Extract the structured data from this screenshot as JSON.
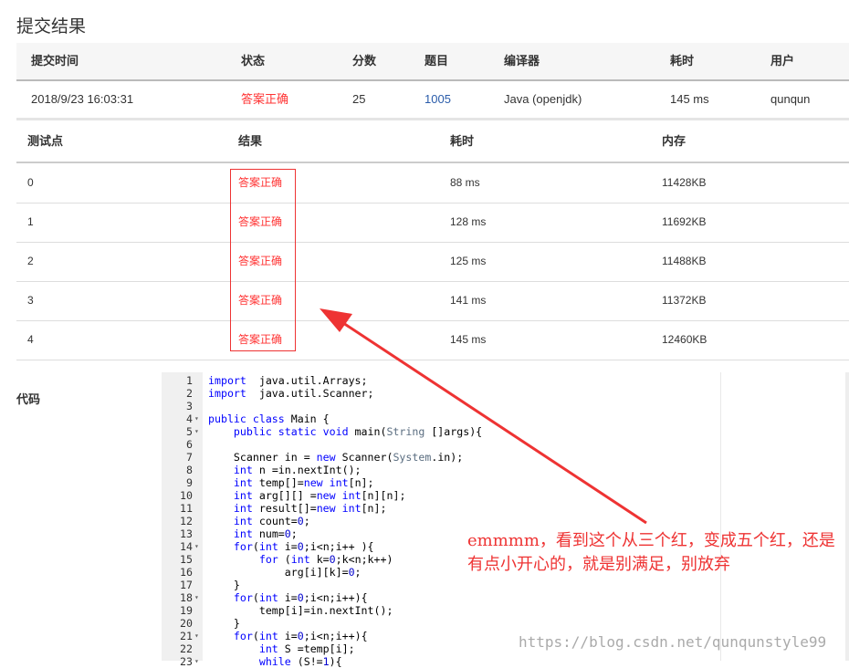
{
  "title": "提交结果",
  "summary": {
    "headers": [
      "提交时间",
      "状态",
      "分数",
      "题目",
      "编译器",
      "耗时",
      "用户"
    ],
    "row": [
      "2018/9/23 16:03:31",
      "答案正确",
      "25",
      "1005",
      "Java (openjdk)",
      "145 ms",
      "qunqun"
    ]
  },
  "tests": {
    "headers": [
      "测试点",
      "结果",
      "耗时",
      "内存"
    ],
    "rows": [
      [
        "0",
        "答案正确",
        "88 ms",
        "11428KB"
      ],
      [
        "1",
        "答案正确",
        "128 ms",
        "11692KB"
      ],
      [
        "2",
        "答案正确",
        "125 ms",
        "11488KB"
      ],
      [
        "3",
        "答案正确",
        "141 ms",
        "11372KB"
      ],
      [
        "4",
        "答案正确",
        "145 ms",
        "12460KB"
      ]
    ]
  },
  "code_label": "代码",
  "code": [
    [
      1,
      "",
      [
        [
          "kw",
          "import"
        ],
        [
          "",
          "  java.util.Arrays;"
        ]
      ]
    ],
    [
      2,
      "",
      [
        [
          "kw",
          "import"
        ],
        [
          "",
          "  java.util.Scanner;"
        ]
      ]
    ],
    [
      3,
      "",
      []
    ],
    [
      4,
      "▾",
      [
        [
          "kw",
          "public class"
        ],
        [
          "",
          " Main {"
        ]
      ]
    ],
    [
      5,
      "▾",
      [
        [
          "",
          "    "
        ],
        [
          "kw",
          "public static void"
        ],
        [
          "",
          " main("
        ],
        [
          "cls",
          "String"
        ],
        [
          "",
          " []args){"
        ]
      ]
    ],
    [
      6,
      "",
      []
    ],
    [
      7,
      "",
      [
        [
          "",
          "    Scanner in = "
        ],
        [
          "kw",
          "new"
        ],
        [
          "",
          " Scanner("
        ],
        [
          "cls",
          "System"
        ],
        [
          "",
          ".in);"
        ]
      ]
    ],
    [
      8,
      "",
      [
        [
          "",
          "    "
        ],
        [
          "kw",
          "int"
        ],
        [
          "",
          " n =in.nextInt();"
        ]
      ]
    ],
    [
      9,
      "",
      [
        [
          "",
          "    "
        ],
        [
          "kw",
          "int"
        ],
        [
          "",
          " temp[]="
        ],
        [
          "kw",
          "new int"
        ],
        [
          "",
          "[n];"
        ]
      ]
    ],
    [
      10,
      "",
      [
        [
          "",
          "    "
        ],
        [
          "kw",
          "int"
        ],
        [
          "",
          " arg[][] ="
        ],
        [
          "kw",
          "new int"
        ],
        [
          "",
          "[n][n];"
        ]
      ]
    ],
    [
      11,
      "",
      [
        [
          "",
          "    "
        ],
        [
          "kw",
          "int"
        ],
        [
          "",
          " result[]="
        ],
        [
          "kw",
          "new int"
        ],
        [
          "",
          "[n];"
        ]
      ]
    ],
    [
      12,
      "",
      [
        [
          "",
          "    "
        ],
        [
          "kw",
          "int"
        ],
        [
          "",
          " count="
        ],
        [
          "num",
          "0"
        ],
        [
          "",
          ";"
        ]
      ]
    ],
    [
      13,
      "",
      [
        [
          "",
          "    "
        ],
        [
          "kw",
          "int"
        ],
        [
          "",
          " num="
        ],
        [
          "num",
          "0"
        ],
        [
          "",
          ";"
        ]
      ]
    ],
    [
      14,
      "▾",
      [
        [
          "",
          "    "
        ],
        [
          "kw",
          "for"
        ],
        [
          "",
          "("
        ],
        [
          "kw",
          "int"
        ],
        [
          "",
          " i="
        ],
        [
          "num",
          "0"
        ],
        [
          "",
          ";i<n;i++ ){"
        ]
      ]
    ],
    [
      15,
      "",
      [
        [
          "",
          "        "
        ],
        [
          "kw",
          "for"
        ],
        [
          "",
          " ("
        ],
        [
          "kw",
          "int"
        ],
        [
          "",
          " k="
        ],
        [
          "num",
          "0"
        ],
        [
          "",
          ";k<n;k++)"
        ]
      ]
    ],
    [
      16,
      "",
      [
        [
          "",
          "            arg[i][k]="
        ],
        [
          "num",
          "0"
        ],
        [
          "",
          ";"
        ]
      ]
    ],
    [
      17,
      "",
      [
        [
          "",
          "    }"
        ]
      ]
    ],
    [
      18,
      "▾",
      [
        [
          "",
          "    "
        ],
        [
          "kw",
          "for"
        ],
        [
          "",
          "("
        ],
        [
          "kw",
          "int"
        ],
        [
          "",
          " i="
        ],
        [
          "num",
          "0"
        ],
        [
          "",
          ";i<n;i++){"
        ]
      ]
    ],
    [
      19,
      "",
      [
        [
          "",
          "        temp[i]=in.nextInt();"
        ]
      ]
    ],
    [
      20,
      "",
      [
        [
          "",
          "    }"
        ]
      ]
    ],
    [
      21,
      "▾",
      [
        [
          "",
          "    "
        ],
        [
          "kw",
          "for"
        ],
        [
          "",
          "("
        ],
        [
          "kw",
          "int"
        ],
        [
          "",
          " i="
        ],
        [
          "num",
          "0"
        ],
        [
          "",
          ";i<n;i++){"
        ]
      ]
    ],
    [
      22,
      "",
      [
        [
          "",
          "        "
        ],
        [
          "kw",
          "int"
        ],
        [
          "",
          " S =temp[i];"
        ]
      ]
    ],
    [
      23,
      "▾",
      [
        [
          "",
          "        "
        ],
        [
          "kw",
          "while"
        ],
        [
          "",
          " (S!="
        ],
        [
          "num",
          "1"
        ],
        [
          "",
          "){"
        ]
      ]
    ]
  ],
  "annotation": {
    "line1": "emmmm，看到这个从三个红，变成五个红，还是",
    "line2": "有点小开心的，就是别满足，别放弃"
  },
  "watermark": "https://blog.csdn.net/qunqunstyle99",
  "colors": {
    "accepted": "#ff3333",
    "arrow": "#ee3333"
  }
}
